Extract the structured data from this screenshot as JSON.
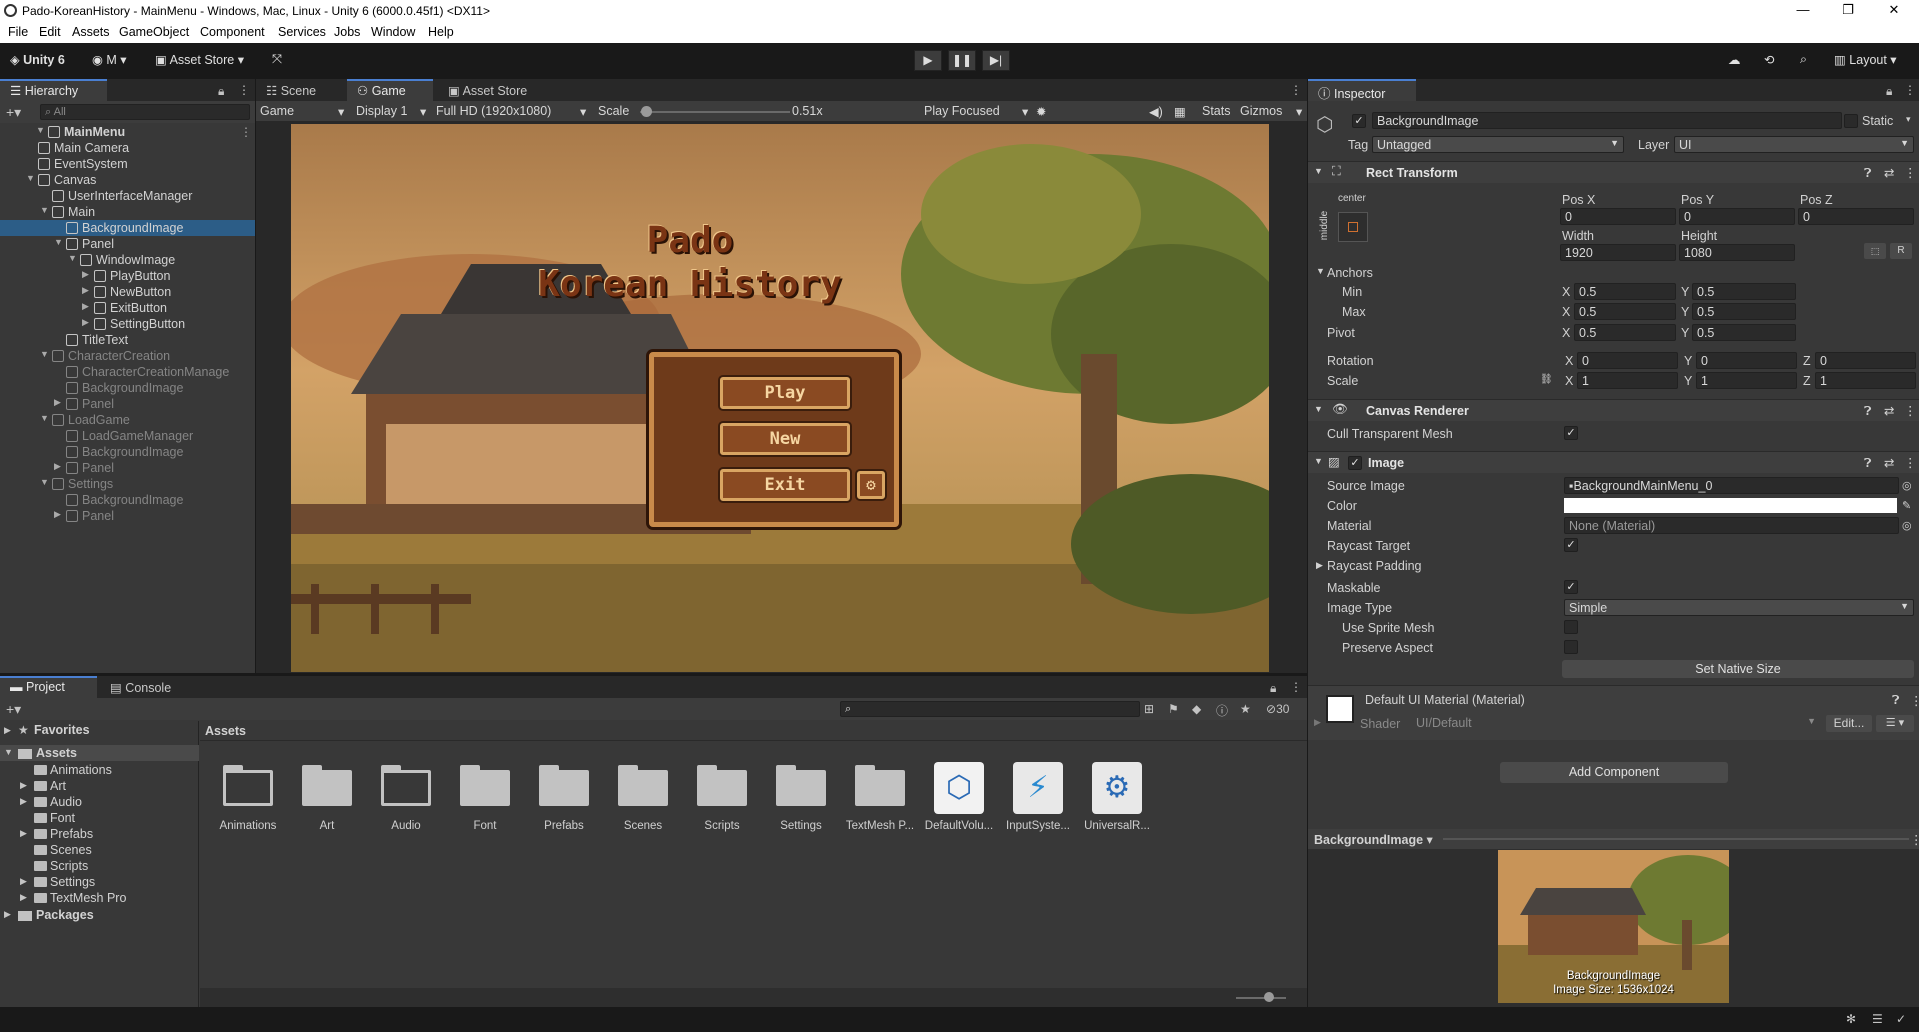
{
  "window": {
    "title": "Pado-KoreanHistory - MainMenu - Windows, Mac, Linux - Unity 6 (6000.0.45f1) <DX11>"
  },
  "menu": [
    "File",
    "Edit",
    "Assets",
    "GameObject",
    "Component",
    "Services",
    "Jobs",
    "Window",
    "Help"
  ],
  "toolbar": {
    "unity": "Unity 6",
    "account": "M",
    "asset_store": "Asset Store",
    "layout": "Layout"
  },
  "hierarchy": {
    "tab": "Hierarchy",
    "search_placeholder": "All",
    "items": [
      {
        "label": "MainMenu",
        "depth": 0,
        "arrow": "open",
        "dim": false,
        "sel": false,
        "scene": true
      },
      {
        "label": "Main Camera",
        "depth": 1,
        "arrow": "",
        "dim": false,
        "sel": false
      },
      {
        "label": "EventSystem",
        "depth": 1,
        "arrow": "",
        "dim": false,
        "sel": false
      },
      {
        "label": "Canvas",
        "depth": 1,
        "arrow": "open",
        "dim": false,
        "sel": false
      },
      {
        "label": "UserInterfaceManager",
        "depth": 2,
        "arrow": "",
        "dim": false,
        "sel": false
      },
      {
        "label": "Main",
        "depth": 2,
        "arrow": "open",
        "dim": false,
        "sel": false
      },
      {
        "label": "BackgroundImage",
        "depth": 3,
        "arrow": "",
        "dim": false,
        "sel": true
      },
      {
        "label": "Panel",
        "depth": 3,
        "arrow": "open",
        "dim": false,
        "sel": false
      },
      {
        "label": "WindowImage",
        "depth": 4,
        "arrow": "open",
        "dim": false,
        "sel": false
      },
      {
        "label": "PlayButton",
        "depth": 5,
        "arrow": "closed",
        "dim": false,
        "sel": false
      },
      {
        "label": "NewButton",
        "depth": 5,
        "arrow": "closed",
        "dim": false,
        "sel": false
      },
      {
        "label": "ExitButton",
        "depth": 5,
        "arrow": "closed",
        "dim": false,
        "sel": false
      },
      {
        "label": "SettingButton",
        "depth": 5,
        "arrow": "closed",
        "dim": false,
        "sel": false
      },
      {
        "label": "TitleText",
        "depth": 3,
        "arrow": "",
        "dim": false,
        "sel": false
      },
      {
        "label": "CharacterCreation",
        "depth": 2,
        "arrow": "open",
        "dim": true,
        "sel": false
      },
      {
        "label": "CharacterCreationManage",
        "depth": 3,
        "arrow": "",
        "dim": true,
        "sel": false
      },
      {
        "label": "BackgroundImage",
        "depth": 3,
        "arrow": "",
        "dim": true,
        "sel": false
      },
      {
        "label": "Panel",
        "depth": 3,
        "arrow": "closed",
        "dim": true,
        "sel": false
      },
      {
        "label": "LoadGame",
        "depth": 2,
        "arrow": "open",
        "dim": true,
        "sel": false
      },
      {
        "label": "LoadGameManager",
        "depth": 3,
        "arrow": "",
        "dim": true,
        "sel": false
      },
      {
        "label": "BackgroundImage",
        "depth": 3,
        "arrow": "",
        "dim": true,
        "sel": false
      },
      {
        "label": "Panel",
        "depth": 3,
        "arrow": "closed",
        "dim": true,
        "sel": false
      },
      {
        "label": "Settings",
        "depth": 2,
        "arrow": "open",
        "dim": true,
        "sel": false
      },
      {
        "label": "BackgroundImage",
        "depth": 3,
        "arrow": "",
        "dim": true,
        "sel": false
      },
      {
        "label": "Panel",
        "depth": 3,
        "arrow": "closed",
        "dim": true,
        "sel": false
      }
    ]
  },
  "scene_tabs": {
    "scene": "Scene",
    "game": "Game",
    "asset_store": "Asset Store"
  },
  "game_bar": {
    "mode": "Game",
    "display": "Display 1",
    "resolution": "Full HD (1920x1080)",
    "scale_label": "Scale",
    "scale_value": "0.51x",
    "play_focused": "Play Focused",
    "stats": "Stats",
    "gizmos": "Gizmos",
    "scale_fraction": 0.04
  },
  "game_view": {
    "title_line1": "Pado",
    "title_line2": "Korean History",
    "buttons": [
      "Play",
      "New",
      "Exit"
    ]
  },
  "inspector": {
    "tab": "Inspector",
    "object_name": "BackgroundImage",
    "static": "Static",
    "tag_label": "Tag",
    "tag": "Untagged",
    "layer_label": "Layer",
    "layer": "UI",
    "rect": {
      "title": "Rect Transform",
      "anchor_preset_h": "center",
      "anchor_preset_v": "middle",
      "posx_label": "Pos X",
      "posy_label": "Pos Y",
      "posz_label": "Pos Z",
      "posx": "0",
      "posy": "0",
      "posz": "0",
      "width_label": "Width",
      "height_label": "Height",
      "width": "1920",
      "height": "1080",
      "anchors": "Anchors",
      "min": "Min",
      "max": "Max",
      "pivot": "Pivot",
      "min_x": "0.5",
      "min_y": "0.5",
      "max_x": "0.5",
      "max_y": "0.5",
      "pivot_x": "0.5",
      "pivot_y": "0.5",
      "rotation": "Rotation",
      "scale": "Scale",
      "rot_x": "0",
      "rot_y": "0",
      "rot_z": "0",
      "sc_x": "1",
      "sc_y": "1",
      "sc_z": "1",
      "x": "X",
      "y": "Y",
      "z": "Z",
      "r": "R"
    },
    "canvas_renderer": {
      "title": "Canvas Renderer",
      "cull": "Cull Transparent Mesh"
    },
    "image": {
      "title": "Image",
      "source_image_label": "Source Image",
      "source_image": "BackgroundMainMenu_0",
      "color_label": "Color",
      "material_label": "Material",
      "material": "None (Material)",
      "raycast_target": "Raycast Target",
      "raycast_padding": "Raycast Padding",
      "maskable": "Maskable",
      "image_type_label": "Image Type",
      "image_type": "Simple",
      "use_sprite_mesh": "Use Sprite Mesh",
      "preserve_aspect": "Preserve Aspect",
      "set_native_size": "Set Native Size"
    },
    "material": {
      "title": "Default UI Material (Material)",
      "shader_label": "Shader",
      "shader": "UI/Default",
      "edit": "Edit..."
    },
    "add_component": "Add Component",
    "preview": {
      "name": "BackgroundImage",
      "caption1": "BackgroundImage",
      "caption2": "Image Size: 1536x1024"
    }
  },
  "project": {
    "tab_project": "Project",
    "tab_console": "Console",
    "count": "30",
    "favorites": "Favorites",
    "assets_root": "Assets",
    "packages": "Packages",
    "breadcrumb": "Assets",
    "tree": [
      "Animations",
      "Art",
      "Audio",
      "Font",
      "Prefabs",
      "Scenes",
      "Scripts",
      "Settings",
      "TextMesh Pro"
    ],
    "grid": [
      {
        "label": "Animations",
        "kind": "folder-empty"
      },
      {
        "label": "Art",
        "kind": "folder"
      },
      {
        "label": "Audio",
        "kind": "folder-empty"
      },
      {
        "label": "Font",
        "kind": "folder"
      },
      {
        "label": "Prefabs",
        "kind": "folder"
      },
      {
        "label": "Scenes",
        "kind": "folder"
      },
      {
        "label": "Scripts",
        "kind": "folder"
      },
      {
        "label": "Settings",
        "kind": "folder"
      },
      {
        "label": "TextMesh P...",
        "kind": "folder"
      },
      {
        "label": "DefaultVolu...",
        "kind": "volume"
      },
      {
        "label": "InputSyste...",
        "kind": "input"
      },
      {
        "label": "UniversalR...",
        "kind": "urp"
      }
    ]
  },
  "colors": {
    "selection": "#2c5d87",
    "accent": "#4a7fd1",
    "panel": "#383838",
    "wood": "#8a4a22"
  }
}
